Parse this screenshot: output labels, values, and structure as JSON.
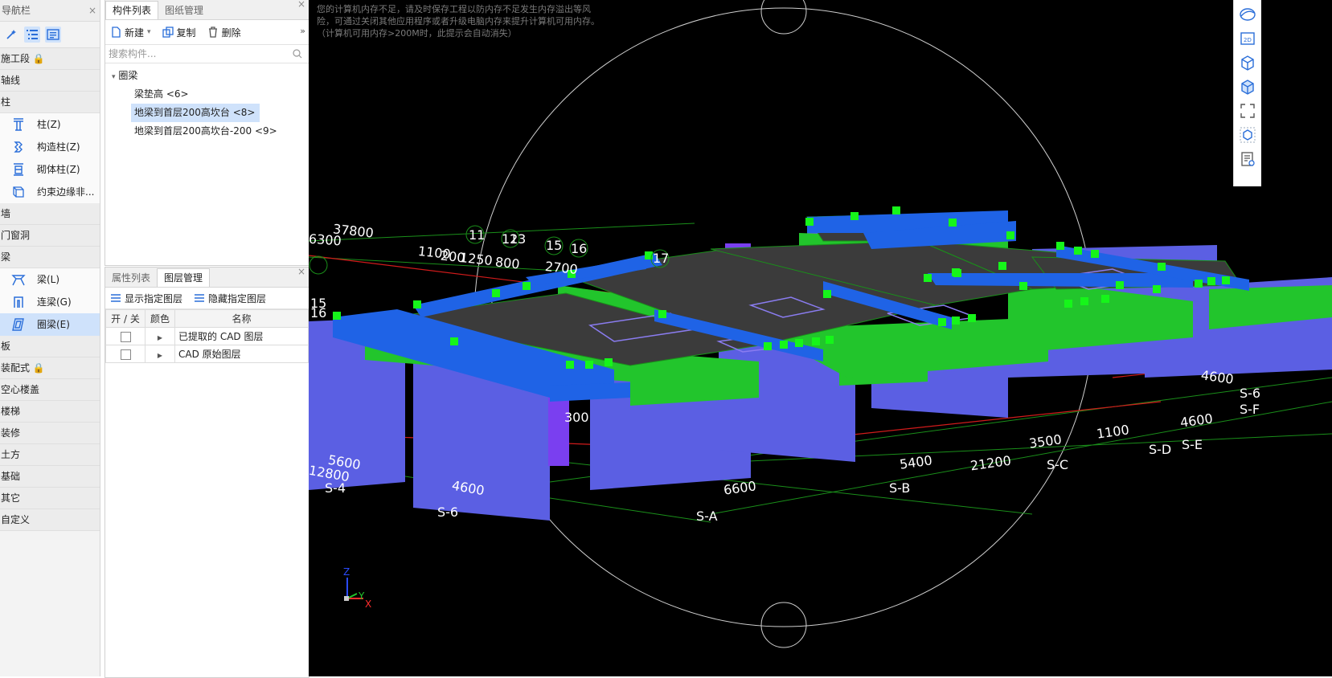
{
  "nav": {
    "title": "导航栏",
    "close": "×",
    "toolbar": [
      "magic-wand-icon",
      "list-tree-icon",
      "detail-view-icon"
    ],
    "categories": [
      {
        "label": "施工段 🔒"
      },
      {
        "label": "轴线"
      },
      {
        "label": "柱",
        "items": [
          {
            "label": "柱(Z)"
          },
          {
            "label": "构造柱(Z)"
          },
          {
            "label": "砌体柱(Z)"
          },
          {
            "label": "约束边缘非..."
          }
        ]
      },
      {
        "label": "墙"
      },
      {
        "label": "门窗洞"
      },
      {
        "label": "梁",
        "items": [
          {
            "label": "梁(L)"
          },
          {
            "label": "连梁(G)"
          },
          {
            "label": "圈梁(E)"
          }
        ]
      },
      {
        "label": "板"
      },
      {
        "label": "装配式 🔒"
      },
      {
        "label": "空心楼盖"
      },
      {
        "label": "楼梯"
      },
      {
        "label": "装修"
      },
      {
        "label": "土方"
      },
      {
        "label": "基础"
      },
      {
        "label": "其它"
      },
      {
        "label": "自定义"
      }
    ]
  },
  "component_panel": {
    "tabs": [
      "构件列表",
      "图纸管理"
    ],
    "close": "×",
    "toolbar": {
      "new": "新建",
      "copy": "复制",
      "delete": "删除",
      "more": "»"
    },
    "search_placeholder": "搜索构件...",
    "tree_root": "圈梁",
    "tree_items": [
      "梁垫高 <6>",
      "地梁到首层200高坎台 <8>",
      "地梁到首层200高坎台-200 <9>"
    ]
  },
  "layer_panel": {
    "tabs": [
      "属性列表",
      "图层管理"
    ],
    "close": "×",
    "toolbar": {
      "show": "显示指定图层",
      "hide": "隐藏指定图层"
    },
    "columns": [
      "开 / 关",
      "颜色",
      "名称"
    ],
    "rows": [
      {
        "name": "已提取的 CAD 图层"
      },
      {
        "name": "CAD 原始图层"
      }
    ]
  },
  "viewport": {
    "warning": "您的计算机内存不足，请及时保存工程以防内存不足发生内存溢出等风险，可通过关闭其他应用程序或者升级电脑内存来提升计算机可用内存。（计算机可用内存>200M时，此提示会自动消失）",
    "dimension_labels": [
      "37800",
      "6300",
      "1100",
      "200",
      "1250",
      "800",
      "2700",
      "5600",
      "12800",
      "4600",
      "5400",
      "21200",
      "6600",
      "3500",
      "1100",
      "4600",
      "4600",
      "300"
    ],
    "axis_bubbles": [
      "11",
      "12",
      "13",
      "15",
      "16",
      "17"
    ],
    "left_axis_labels": [
      "15",
      "16"
    ],
    "grid_labels": [
      "S-4",
      "S-6",
      "S-A",
      "S-B",
      "S-C",
      "S-D",
      "S-E",
      "S-6",
      "S-F"
    ],
    "triad": {
      "z": "Z",
      "y": "Y",
      "x": "X"
    }
  },
  "right_toolbar": [
    "orbit-icon",
    "2d-view-icon",
    "3d-wireframe-icon",
    "3d-solid-icon",
    "fit-view-icon",
    "display-settings-icon",
    "layer-view-icon"
  ],
  "colors": {
    "select_blue": "#cfe2fb",
    "beam_blue": "#1f63e6",
    "wall_purple": "#5b5fe3",
    "slab_green": "#22c52c",
    "grid_green": "#1a8f1a",
    "grid_red": "#d11b1b",
    "marker_green": "#16f51a"
  }
}
